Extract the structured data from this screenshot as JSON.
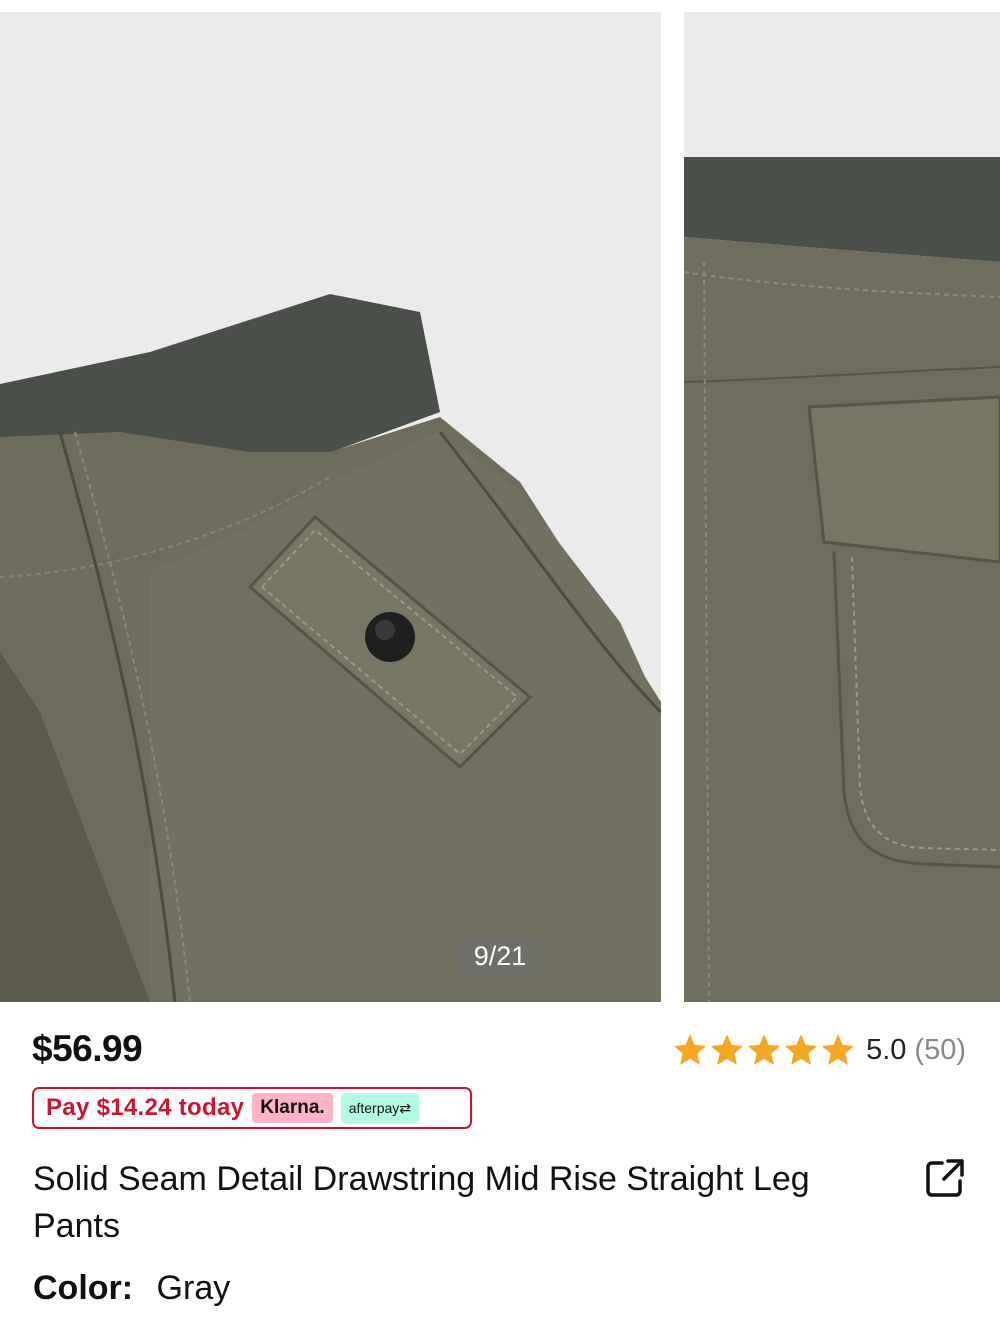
{
  "gallery": {
    "counter": "9/21",
    "images": [
      "product-photo-waistband-pocket",
      "product-photo-back-pocket"
    ]
  },
  "product": {
    "price": "$56.99",
    "rating": {
      "value": "5.0",
      "count": "(50)",
      "stars": 5,
      "star_color": "#f5a623"
    },
    "pay_today": "Pay $14.24 today",
    "klarna": "Klarna.",
    "afterpay": "afterpay",
    "title": "Solid Seam Detail Drawstring Mid Rise Straight Leg Pants",
    "color_label": "Color:",
    "color_value": "Gray"
  },
  "icons": {
    "share": "share-external-icon",
    "star": "star-icon"
  },
  "colors": {
    "accent_red": "#d0142b",
    "klarna_pink": "#ffb3c7",
    "afterpay_mint": "#b2fce4"
  }
}
